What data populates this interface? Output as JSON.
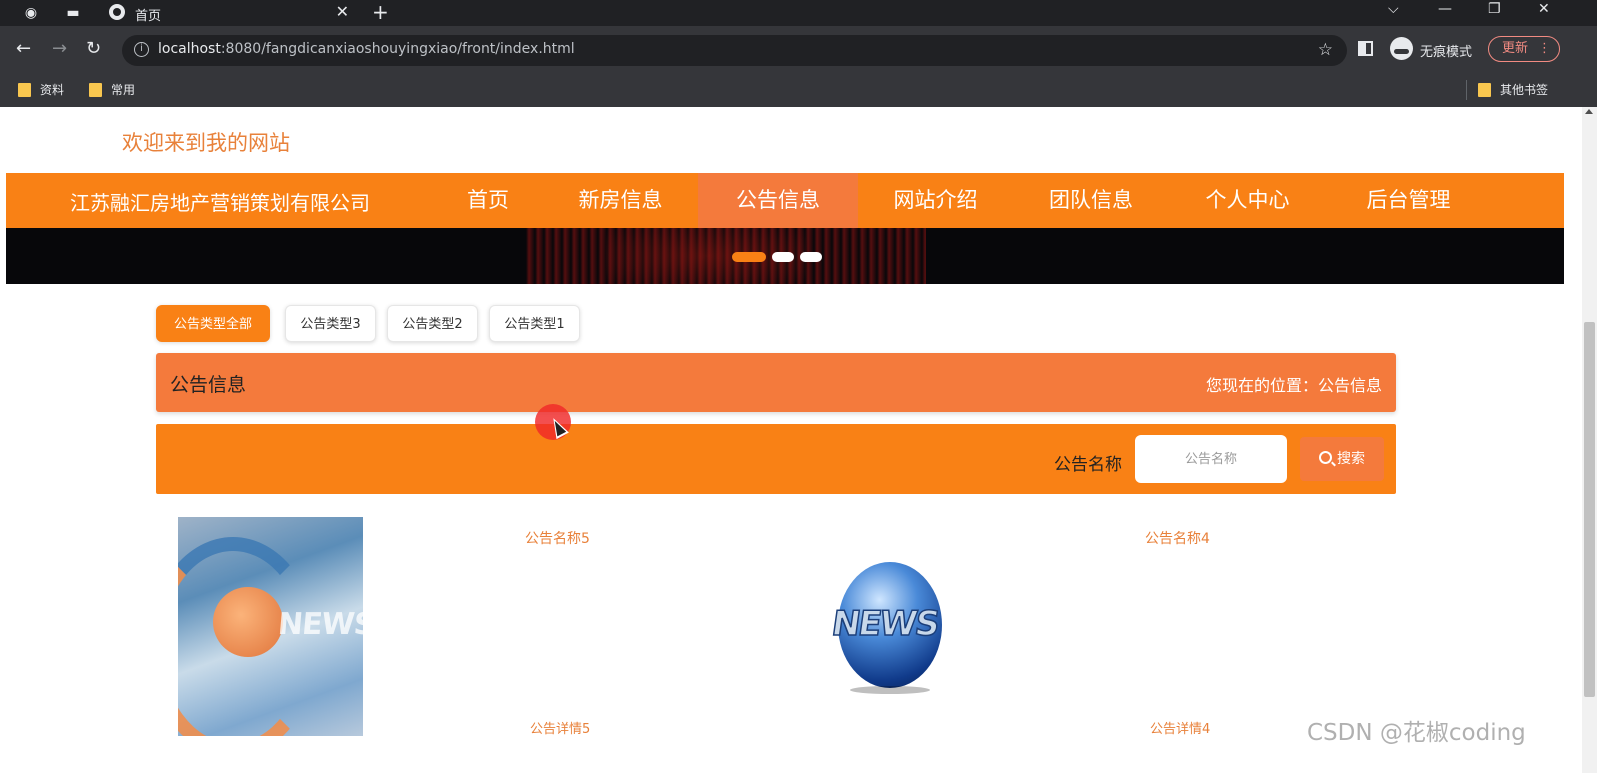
{
  "browser": {
    "tab_title": "首页",
    "url_host": "localhost",
    "url_rest": ":8080/fangdicanxiaoshouyingxiao/front/index.html",
    "incognito_label": "无痕模式",
    "update_label": "更新",
    "bookmarks": [
      "资料",
      "常用"
    ],
    "other_bookmarks": "其他书签"
  },
  "site": {
    "welcome": "欢迎来到我的网站",
    "brand": "江苏融汇房地产营销策划有限公司",
    "nav": [
      "首页",
      "新房信息",
      "公告信息",
      "网站介绍",
      "团队信息",
      "个人中心",
      "后台管理"
    ],
    "active_nav": "公告信息"
  },
  "banner": {
    "slide_count": 3,
    "active_slide": 1
  },
  "filters": {
    "types": [
      "公告类型全部",
      "公告类型3",
      "公告类型2",
      "公告类型1"
    ],
    "active": "公告类型全部"
  },
  "breadcrumb": {
    "title": "公告信息",
    "location": "您现在的位置：公告信息"
  },
  "search": {
    "label": "公告名称",
    "placeholder": "公告名称",
    "button": "搜索"
  },
  "news": [
    {
      "title": "公告名称5",
      "detail": "公告详情5",
      "image": "news-swirl-image"
    },
    {
      "title": "公告名称4",
      "detail": "公告详情4",
      "image": "news-globe-image"
    }
  ],
  "watermark": "CSDN @花椒coding",
  "colors": {
    "primary": "#f98115",
    "accent": "#f47a3c",
    "text_orange": "#e8813a"
  }
}
